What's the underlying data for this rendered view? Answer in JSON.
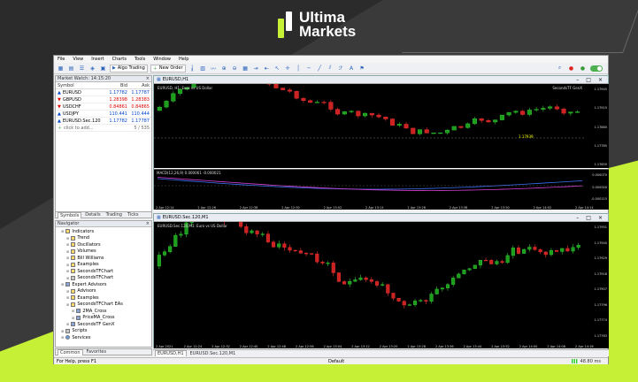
{
  "brand": {
    "name_line1": "Ultima",
    "name_line2": "Markets",
    "accent": "#c6f035"
  },
  "menu": [
    "File",
    "View",
    "Insert",
    "Charts",
    "Tools",
    "Window",
    "Help"
  ],
  "toolbar": {
    "algo_trading": "Algo Trading",
    "new_order": "New Order"
  },
  "market_watch": {
    "title": "Market Watch: 14:15:20",
    "columns": [
      "Symbol",
      "Bid",
      "Ask"
    ],
    "rows": [
      {
        "symbol": "EURUSD",
        "bid": "1.17782",
        "ask": "1.17787",
        "dir": "up"
      },
      {
        "symbol": "GBPUSD",
        "bid": "1.28398",
        "ask": "1.28383",
        "dir": "dn"
      },
      {
        "symbol": "USDCHF",
        "bid": "0.84861",
        "ask": "0.84865",
        "dir": "dn"
      },
      {
        "symbol": "USDJPY",
        "bid": "110.441",
        "ask": "110.444",
        "dir": "up"
      },
      {
        "symbol": "EURUSD.Sec.120",
        "bid": "1.17782",
        "ask": "1.17787",
        "dir": "up"
      }
    ],
    "add_row": "click to add...",
    "count": "5 / 535",
    "tabs": [
      "Symbols",
      "Details",
      "Trading",
      "Ticks"
    ]
  },
  "navigator": {
    "title": "Navigator",
    "items": [
      {
        "label": "Indicators",
        "indent": 1,
        "type": "folder"
      },
      {
        "label": "Trend",
        "indent": 2,
        "type": "folder"
      },
      {
        "label": "Oscillators",
        "indent": 2,
        "type": "folder"
      },
      {
        "label": "Volumes",
        "indent": 2,
        "type": "folder"
      },
      {
        "label": "Bill Williams",
        "indent": 2,
        "type": "folder"
      },
      {
        "label": "Examples",
        "indent": 2,
        "type": "folder"
      },
      {
        "label": "SecondsTFChart",
        "indent": 2,
        "type": "folder"
      },
      {
        "label": "SecondsTFChart",
        "indent": 2,
        "type": "script"
      },
      {
        "label": "Expert Advisors",
        "indent": 1,
        "type": "ea"
      },
      {
        "label": "Advisors",
        "indent": 2,
        "type": "folder"
      },
      {
        "label": "Examples",
        "indent": 2,
        "type": "folder"
      },
      {
        "label": "SecondsTFChart EAs",
        "indent": 2,
        "type": "folder"
      },
      {
        "label": "2MA_Cross",
        "indent": 3,
        "type": "ea"
      },
      {
        "label": "PriceMA_Cross",
        "indent": 3,
        "type": "ea"
      },
      {
        "label": "SecondsTF GenX",
        "indent": 2,
        "type": "ea"
      },
      {
        "label": "Scripts",
        "indent": 1,
        "type": "script"
      },
      {
        "label": "Services",
        "indent": 1,
        "type": "service"
      }
    ],
    "tabs": [
      "Common",
      "Favorites"
    ]
  },
  "chart1": {
    "window_title": "EURUSD,H1",
    "legend": "EURUSD, H1: Euro vs US Dollar",
    "ea_label": "SecondsTF GenX",
    "indicator_label": "MACD(12,26,9) 0.000061 -0.000021",
    "price_tag": "1.17939",
    "y_ticks": [
      "1.17945",
      "1.17915",
      "1.17880",
      "1.17785",
      "1.17650"
    ],
    "macd_ticks": [
      "0.000070",
      "0.000000",
      "-0.000115"
    ],
    "x_ticks": [
      "2 Apr 12:14",
      "2 Apr 12:26",
      "2 Apr 12:38",
      "2 Apr 12:50",
      "2 Apr 13:02",
      "2 Apr 13:14",
      "2 Apr 13:26",
      "2 Apr 13:38",
      "2 Apr 13:50",
      "2 Apr 14:02",
      "2 Apr 14:14"
    ]
  },
  "chart2": {
    "window_title": "EURUSD.Sec.120,M1",
    "legend": "EURUSD.Sec.120,M1: Euro vs US Dollar",
    "y_ticks": [
      "1.17951",
      "1.17940",
      "1.17929",
      "1.17918",
      "1.17907",
      "1.17796",
      "1.17774",
      "1.17763"
    ],
    "x_ticks": [
      "2 Apr 2021",
      "2 Apr 12:24",
      "2 Apr 12:32",
      "2 Apr 12:40",
      "2 Apr 12:48",
      "2 Apr 12:56",
      "2 Apr 13:04",
      "2 Apr 13:12",
      "2 Apr 13:20",
      "2 Apr 13:28",
      "2 Apr 13:36",
      "2 Apr 13:44",
      "2 Apr 13:52",
      "2 Apr 14:00",
      "2 Apr 14:08",
      "2 Apr 14:16"
    ]
  },
  "chart_tabs": [
    "EURUSD,H1",
    "EURUSD.Sec.120,M1"
  ],
  "status": {
    "help": "For Help, press F1",
    "profile": "Default",
    "net": "48.80 ms"
  }
}
